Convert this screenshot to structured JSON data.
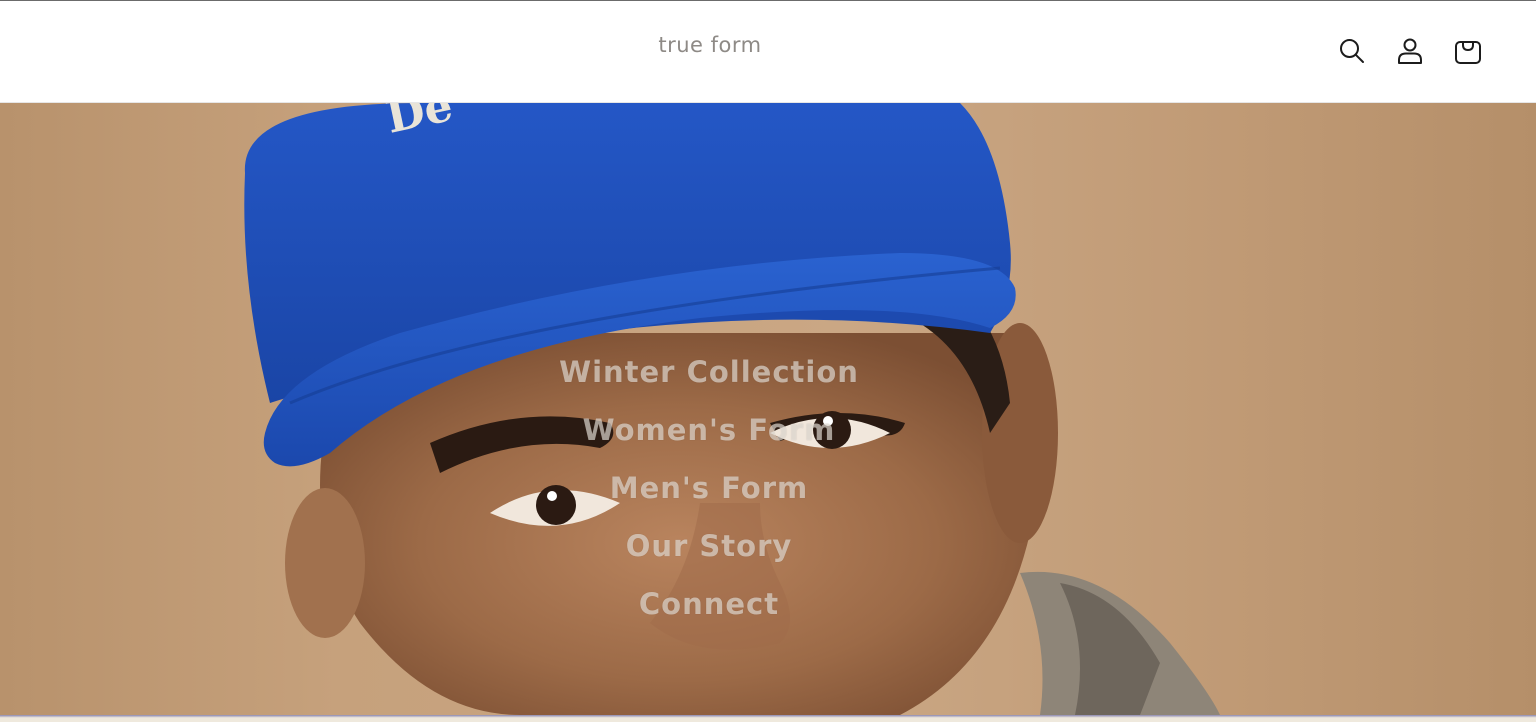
{
  "header": {
    "logo_text": "true form",
    "icons": [
      "search-icon",
      "account-icon",
      "cart-icon"
    ]
  },
  "hero": {
    "cap_text": "De",
    "menu": [
      {
        "label": "Winter Collection"
      },
      {
        "label": "Women's Form"
      },
      {
        "label": "Men's Form"
      },
      {
        "label": "Our Story"
      },
      {
        "label": "Connect"
      }
    ]
  },
  "colors": {
    "logo": "#8e8a86",
    "icon_stroke": "#1c1c1c",
    "hero_background": "#c6a17c",
    "cap_blue": "#1f4fb8",
    "menu_text": "rgba(238,232,226,0.62)"
  }
}
